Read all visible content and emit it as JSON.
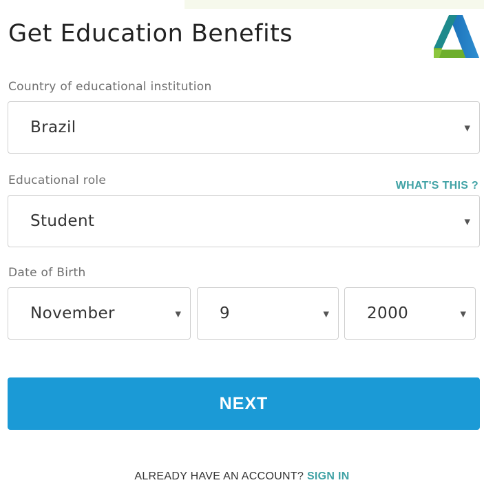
{
  "header": {
    "title": "Get Education Benefits",
    "logo_icon": "autodesk-logo-icon"
  },
  "form": {
    "country": {
      "label": "Country of educational institution",
      "value": "Brazil"
    },
    "role": {
      "label": "Educational role",
      "help_link": "WHAT'S THIS ?",
      "value": "Student"
    },
    "dob": {
      "label": "Date of Birth",
      "month": "November",
      "day": "9",
      "year": "2000"
    },
    "next_label": "NEXT"
  },
  "footer": {
    "prompt": "ALREADY HAVE AN ACCOUNT?",
    "signin_label": "SIGN IN"
  },
  "colors": {
    "accent_blue": "#1b9ad6",
    "link_teal": "#40a2a5",
    "border_gray": "#cfcfcf"
  }
}
